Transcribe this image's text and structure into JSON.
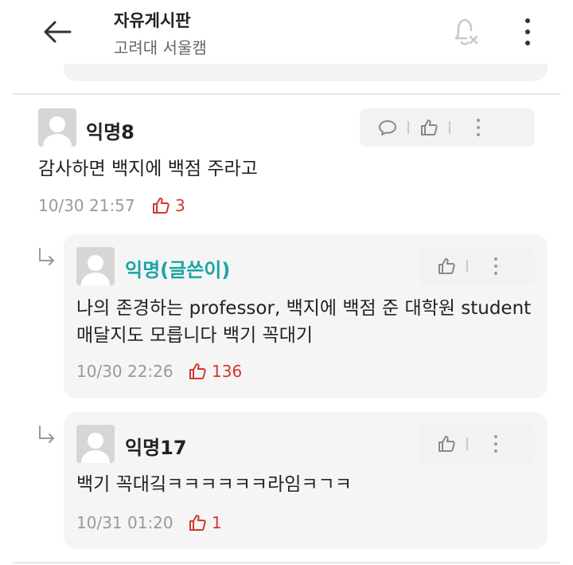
{
  "header": {
    "title": "자유게시판",
    "subtitle": "고려대 서울캠"
  },
  "comments": [
    {
      "author": "익명8",
      "content": "감사하면 백지에 백점 주라고",
      "time": "10/30 21:57",
      "likes": "3"
    }
  ],
  "replies": [
    {
      "author": "익명(글쓴이)",
      "is_op": true,
      "content": "나의 존경하는 professor, 백지에 백점 준 대학원 student 매달지도 모릅니다 백기 꼭대기",
      "time": "10/30 22:26",
      "likes": "136"
    },
    {
      "author": "익명17",
      "is_op": false,
      "content": "백기 꼭대깈ㅋㅋㅋㅋㅋㅋ라임ㅋㄱㅋ",
      "time": "10/31 01:20",
      "likes": "1"
    }
  ],
  "colors": {
    "op_author": "#1ba5a5",
    "like_red": "#d0392b",
    "meta_gray": "#9a9a9a"
  },
  "icons": [
    "back-arrow-icon",
    "bell-off-icon",
    "more-vertical-icon",
    "comment-icon",
    "thumbs-up-icon",
    "reply-arrow-icon",
    "avatar-icon"
  ]
}
